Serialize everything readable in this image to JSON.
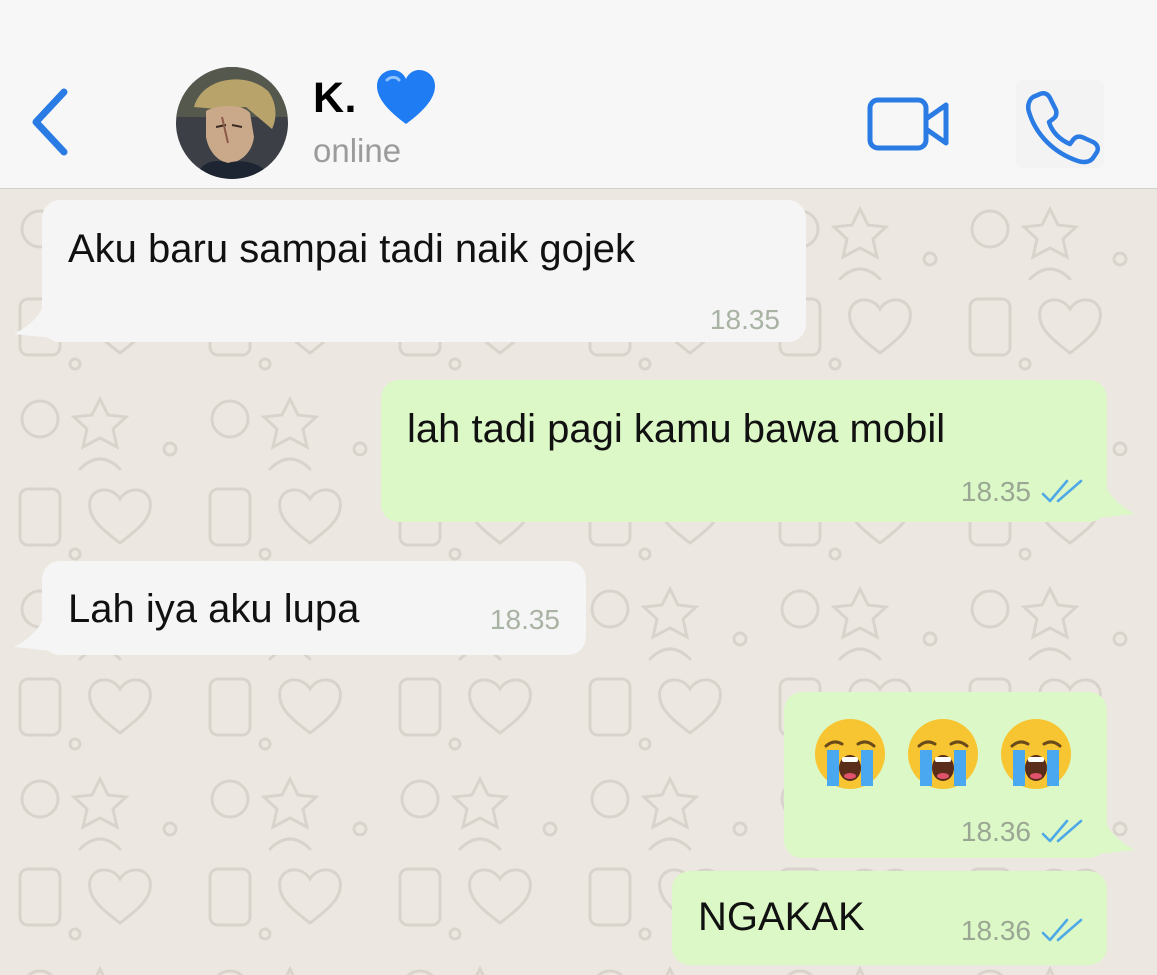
{
  "header": {
    "contact_name": "K.",
    "status": "online"
  },
  "icons": {
    "back": "chevron-left-icon",
    "heart": "blue-heart-emoji",
    "video": "video-camera-icon",
    "call": "phone-icon",
    "read": "double-check-icon",
    "emoji": "loudly-crying-face-emoji"
  },
  "colors": {
    "accent": "#2a7be4",
    "outgoing_bubble": "#dcf8c6",
    "incoming_bubble": "#f5f5f5",
    "read_ticks": "#4fa9e6"
  },
  "messages": [
    {
      "direction": "incoming",
      "text": "Aku baru sampai tadi naik gojek",
      "time": "18.35"
    },
    {
      "direction": "outgoing",
      "text": "lah tadi pagi kamu bawa mobil",
      "time": "18.35",
      "read": true
    },
    {
      "direction": "incoming",
      "text": "Lah iya aku lupa",
      "time": "18.35"
    },
    {
      "direction": "outgoing",
      "emoji_count": 3,
      "time": "18.36",
      "read": true
    },
    {
      "direction": "outgoing",
      "text": "NGAKAK",
      "time": "18.36",
      "read": true
    }
  ]
}
